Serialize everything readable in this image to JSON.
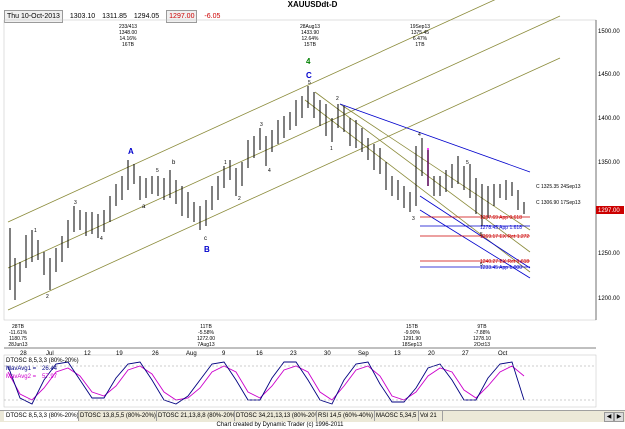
{
  "window": {
    "title": "XAUUSDdt-D"
  },
  "infobar": {
    "date": "Thu 10-Oct-2013",
    "open": "1303.10",
    "high": "1311.85",
    "low": "1294.05",
    "close": "1297.00",
    "change": "-6.05"
  },
  "price_axis": {
    "labels": [
      "1500.00",
      "1450.00",
      "1400.00",
      "1350.00",
      "1300.00",
      "1250.00",
      "1200.00"
    ],
    "current_price": "1297.00"
  },
  "date_axis": {
    "labels": [
      "28",
      "Jul",
      "12",
      "19",
      "26",
      "Aug",
      "9",
      "16",
      "23",
      "30",
      "Sep",
      "13",
      "20",
      "27",
      "Oct"
    ]
  },
  "swing_labels": {
    "top_left": [
      "233/413",
      "1348.00",
      "14.16%",
      "16TB"
    ],
    "top_mid": [
      "28Aug13",
      "1433.90",
      "12.64%",
      "15TB"
    ],
    "top_right": [
      "19Sep13",
      "1375.45",
      "6.47%",
      "1TB"
    ],
    "bot_1": [
      "28TB",
      "-11.61%",
      "1180.75",
      "28Jun13"
    ],
    "bot_2": [
      "11TB",
      "-5.58%",
      "1272.00",
      "7Aug13"
    ],
    "bot_3": [
      "15TB",
      "-9.90%",
      "1291.90",
      "18Sep13"
    ],
    "bot_4": [
      "9TB",
      "-7.88%",
      "1278.10",
      "2Oct13"
    ]
  },
  "wave_labels": {
    "A": "A",
    "B": "B",
    "C": "C",
    "wave4": "4",
    "c_small": "c",
    "b_small": "b",
    "a_small": "a",
    "n1": "1",
    "n2": "2",
    "n3": "3",
    "n4": "4",
    "n5": "5"
  },
  "levels": [
    {
      "text": "C 1325.35 24Sep13",
      "color": "#000000"
    },
    {
      "text": "C 1306.90 17Sep13",
      "color": "#000000"
    },
    {
      "text": "1287.69 App 0.618",
      "color": "#cc0000"
    },
    {
      "text": "1278.45 App 1.618",
      "color": "#0000cc"
    },
    {
      "text": "1269.17 EX Ret 1.272",
      "color": "#cc0000"
    },
    {
      "text": "1240.27 EX Ret 1.618",
      "color": "#cc0000"
    },
    {
      "text": "1233.45 App 1.000",
      "color": "#0000cc"
    }
  ],
  "indicator": {
    "title": "DTOSC 8,5,3,3 (80%-20%)",
    "mav1_label": "MavAvg1 =",
    "mav1_value": "26.44",
    "mav2_label": "MavAvg2 =",
    "mav2_value": "57.97",
    "colors": {
      "mav1": "#000080",
      "mav2": "#cc00cc"
    }
  },
  "tabs": [
    "DTOSC 8,5,3,3 (80%-20%)",
    "DTOSC 13,8,5,5 (80%-20%)",
    "DTOSC 21,13,8,8 (80%-20%)",
    "DTOSC 34,21,13,13 (80%-20%)",
    "RSI 14,5 (60%-40%)",
    "MAOSC 5,34,5",
    "Vol 21"
  ],
  "footer": {
    "credit": "Chart created by Dynamic Trader  (c) 1996-2011"
  },
  "colors": {
    "channel": "#8b8b3a",
    "blue_line": "#0000cc",
    "red_line": "#cc0000",
    "magenta": "#ff00ff",
    "bars": "#000000"
  }
}
